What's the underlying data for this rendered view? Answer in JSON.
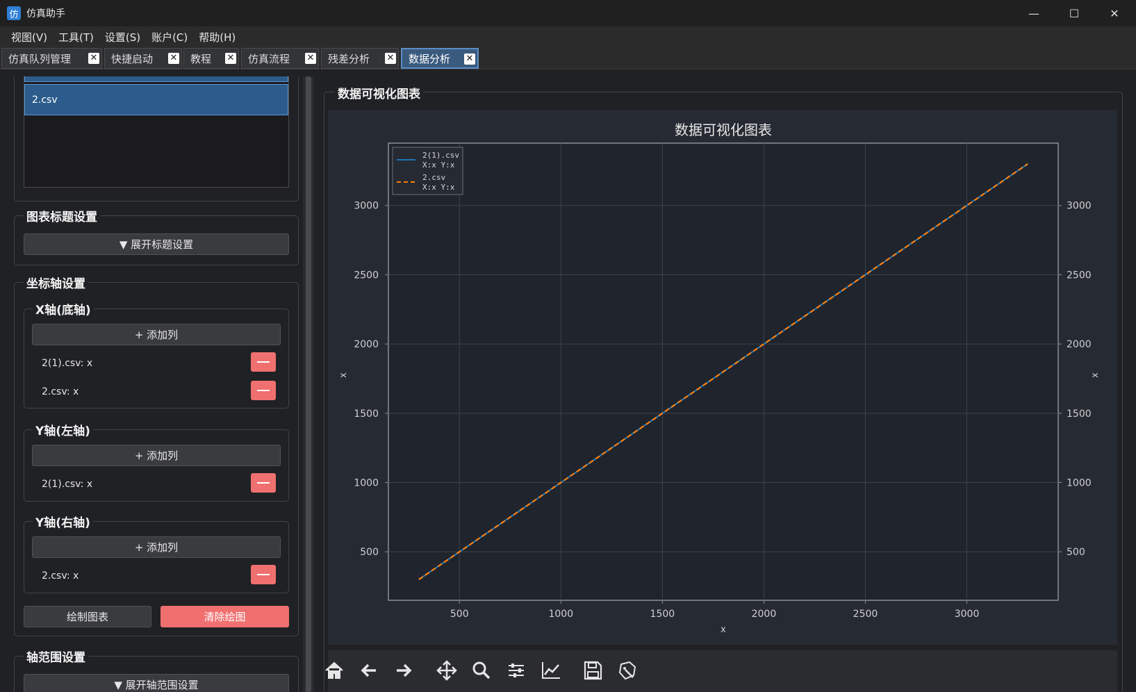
{
  "app": {
    "title": "仿真助手",
    "icon_glyph": "仿"
  },
  "window_controls": {
    "minimize": "—",
    "maximize": "☐",
    "close": "✕"
  },
  "menu": [
    "视图(V)",
    "工具(T)",
    "设置(S)",
    "账户(C)",
    "帮助(H)"
  ],
  "tabs": [
    {
      "label": "仿真队列管理",
      "close": "✕"
    },
    {
      "label": "快捷启动",
      "close": "✕"
    },
    {
      "label": "教程",
      "close": "✕"
    },
    {
      "label": "仿真流程",
      "close": "✕"
    },
    {
      "label": "残差分析",
      "close": "✕"
    },
    {
      "label": "数据分析",
      "close": "✕",
      "active": true
    }
  ],
  "file_list": {
    "items": [
      "2.csv"
    ]
  },
  "title_settings": {
    "title": "图表标题设置",
    "expand_button": "▼ 展开标题设置"
  },
  "axis_settings": {
    "title": "坐标轴设置",
    "x_axis": {
      "title": "X轴(底轴)",
      "add_button": "+ 添加列",
      "columns": [
        "2(1).csv: x",
        "2.csv: x"
      ]
    },
    "y_left": {
      "title": "Y轴(左轴)",
      "add_button": "+ 添加列",
      "columns": [
        "2(1).csv: x"
      ]
    },
    "y_right": {
      "title": "Y轴(右轴)",
      "add_button": "+ 添加列",
      "columns": [
        "2.csv: x"
      ]
    }
  },
  "actions": {
    "draw": "绘制图表",
    "clear": "清除绘图"
  },
  "range_settings": {
    "title": "轴范围设置",
    "expand_button": "▼ 展开轴范围设置"
  },
  "chart_panel": {
    "group_title": "数据可视化图表"
  },
  "colors": {
    "series1": "#1f77b4",
    "series2": "#ff7f0e",
    "accent": "#5a8fc8",
    "danger": "#f07070"
  },
  "toolbar_icons": [
    "home-icon",
    "back-arrow-icon",
    "forward-arrow-icon",
    "pan-icon",
    "zoom-icon",
    "configure-subplots-icon",
    "edit-axes-icon",
    "save-icon",
    "customize-icon"
  ],
  "chart_data": {
    "type": "line",
    "title": "数据可视化图表",
    "xlabel": "x",
    "ylabel": "x",
    "ylabel_right": "x",
    "xlim": [
      150,
      3450
    ],
    "ylim": [
      150,
      3450
    ],
    "ylim_right": [
      150,
      3450
    ],
    "x_ticks": [
      500,
      1000,
      1500,
      2000,
      2500,
      3000
    ],
    "y_ticks": [
      500,
      1000,
      1500,
      2000,
      2500,
      3000
    ],
    "grid": true,
    "legend_position": "top-left",
    "series": [
      {
        "name": "2(1).csv",
        "name_sub": "X:x Y:x",
        "style": "solid",
        "axis": "left",
        "x": [
          300,
          3300
        ],
        "y": [
          300,
          3300
        ]
      },
      {
        "name": "2.csv",
        "name_sub": "X:x Y:x",
        "style": "dashed",
        "axis": "right",
        "x": [
          300,
          3300
        ],
        "y": [
          300,
          3300
        ]
      }
    ]
  }
}
